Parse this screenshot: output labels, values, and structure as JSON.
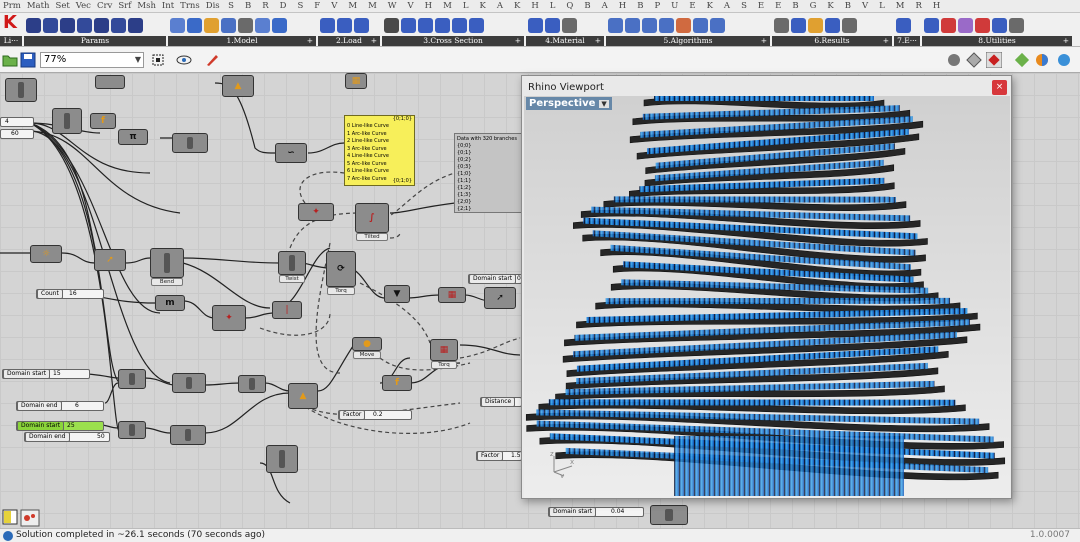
{
  "menu": [
    "Prm",
    "Math",
    "Set",
    "Vec",
    "Crv",
    "Srf",
    "Msh",
    "Int",
    "Trns",
    "Dis",
    "S",
    "B",
    "R",
    "D",
    "S",
    "F",
    "V",
    "M",
    "M",
    "W",
    "V",
    "H",
    "M",
    "L",
    "K",
    "A",
    "K",
    "H",
    "L",
    "Q",
    "B",
    "A",
    "H",
    "B",
    "P",
    "U",
    "E",
    "K",
    "A",
    "S",
    "E",
    "E",
    "B",
    "G",
    "K",
    "B",
    "V",
    "L",
    "M",
    "R",
    "H"
  ],
  "toolbar_groups": [
    {
      "label": "Li···"
    },
    {
      "label": "Params"
    },
    {
      "label": "1.Model"
    },
    {
      "label": "2.Load"
    },
    {
      "label": "3.Cross Section"
    },
    {
      "label": "4.Material"
    },
    {
      "label": "5.Algorithms"
    },
    {
      "label": "6.Results"
    },
    {
      "label": "7.E···"
    },
    {
      "label": "8.Utilities"
    }
  ],
  "canvas_toolbar": {
    "zoom": "77%"
  },
  "canvas": {
    "sliders": [
      {
        "label": "Count",
        "value": "16"
      },
      {
        "label": "Domain start",
        "value": "15"
      },
      {
        "label": "Domain end",
        "value": "6"
      },
      {
        "label": "Domain start",
        "value": "25"
      },
      {
        "label": "Domain end",
        "value": "50"
      },
      {
        "label": "Factor",
        "value": "0.2"
      },
      {
        "label": "Domain start",
        "value": "0.04"
      },
      {
        "label": "Domain start",
        "value": "0.0"
      },
      {
        "label": "Distance",
        "value": ""
      },
      {
        "label": "Factor",
        "value": "1.5"
      }
    ],
    "left_values": [
      "4",
      "60"
    ],
    "yellow_panel": {
      "header": "{0;1;0}",
      "lines": [
        "0 Line-like Curve",
        "1 Arc-like Curve",
        "2 Line-like Curve",
        "3 Arc-like Curve",
        "4 Line-like Curve",
        "5 Arc-like Curve",
        "6 Line-like Curve",
        "7 Arc-like Curve"
      ],
      "footer": "{0;1;0}"
    },
    "data_panel": {
      "header": "Data with 320 branches",
      "rows": [
        "{0;0}",
        "{0;1}",
        "{0;2}",
        "{0;3}",
        "{1;0}",
        "{1;1}",
        "{1;2}",
        "{1;3}",
        "{2;0}",
        "{2;1}"
      ]
    },
    "captions": [
      "Bend",
      "Twist",
      "Torq",
      "Torq",
      "Move",
      "Tilted"
    ]
  },
  "viewport": {
    "title": "Rhino Viewport",
    "view": "Perspective",
    "close": "×"
  },
  "status": {
    "text": "Solution completed in ~26.1 seconds (70 seconds ago)",
    "version": "1.0.0007"
  },
  "colors": {
    "accent": "#d7373b",
    "slider_green": "#9be04d",
    "panel_yellow": "#f7ef5a",
    "tab_blue": "#6788a8"
  }
}
